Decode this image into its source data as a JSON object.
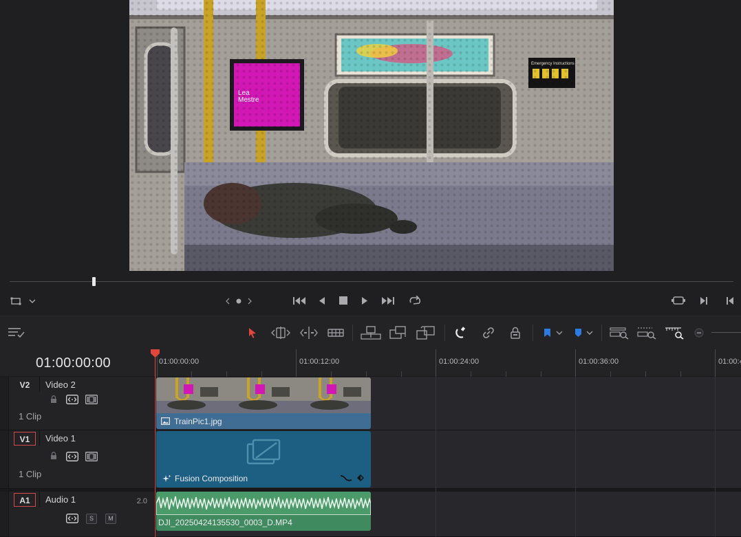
{
  "timeline": {
    "timecode": "01:00:00:00",
    "ruler_labels": [
      "01:00:00:00",
      "01:00:12:00",
      "01:00:24:00",
      "01:00:36:00",
      "01:00:4"
    ]
  },
  "tracks": {
    "v2": {
      "id": "V2",
      "name": "Video 2",
      "clip_count": "1 Clip"
    },
    "v1": {
      "id": "V1",
      "name": "Video 1",
      "clip_count": "1 Clip"
    },
    "a1": {
      "id": "A1",
      "name": "Audio 1",
      "channels": "2.0",
      "solo_label": "S",
      "mute_label": "M"
    }
  },
  "clips": {
    "image_clip": "TrainPic1.jpg",
    "fusion_clip": "Fusion Composition",
    "audio_clip": "DJI_20250424135530_0003_D.MP4"
  },
  "viewer_frame": {
    "poster_text": "Lea\nMestre",
    "sign_text": "Emergency Instructions"
  },
  "colors": {
    "playhead": "#e0463a",
    "image_clip": "#3f6d93",
    "fusion_clip": "#1d5f82",
    "audio_clip": "#3f8a5f",
    "accent_blue": "#2d7be0"
  },
  "icons": [
    "crop-icon",
    "chevron-down-icon",
    "jog-prev-icon",
    "jog-dot-icon",
    "jog-next-icon",
    "skip-to-start-icon",
    "step-back-icon",
    "stop-icon",
    "play-icon",
    "skip-to-end-icon",
    "loop-icon",
    "match-frame-icon",
    "next-clip-icon",
    "prev-clip-icon",
    "timeline-options-icon",
    "selection-arrow-icon",
    "trim-edit-icon",
    "dynamic-trim-icon",
    "blade-icon",
    "insert-clip-icon",
    "overwrite-clip-icon",
    "replace-clip-icon",
    "snapping-icon",
    "linked-selection-icon",
    "position-lock-icon",
    "flag-icon",
    "marker-icon",
    "zoom-full-icon",
    "zoom-detail-icon",
    "zoom-custom-icon",
    "zoom-out-icon",
    "lock-icon",
    "auto-select-icon",
    "clip-toggle-icon",
    "image-icon",
    "fusion-sparkle-icon",
    "keyframe-curve-icon",
    "keyframe-diamond-icon",
    "fusion-composition-icon"
  ]
}
